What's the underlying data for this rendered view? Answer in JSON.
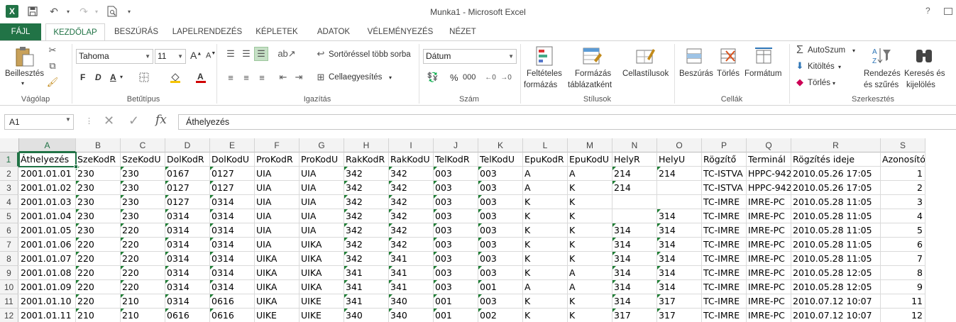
{
  "window": {
    "title": "Munka1 - Microsoft Excel",
    "help": "?"
  },
  "tabs": {
    "file": "FÁJL",
    "home": "KEZDŐLAP",
    "insert": "BESZÚRÁS",
    "layout": "LAPELRENDEZÉS",
    "formulas": "KÉPLETEK",
    "data": "ADATOK",
    "review": "VÉLEMÉNYEZÉS",
    "view": "NÉZET"
  },
  "ribbon": {
    "paste": "Beillesztés",
    "clipboard": "Vágólap",
    "font_name": "Tahoma",
    "font_size": "11",
    "bold": "F",
    "italic": "D",
    "underline": "A",
    "font_group": "Betűtípus",
    "wrap": "Sortöréssel több sorba",
    "merge": "Cellaegyesítés",
    "alignment": "Igazítás",
    "number_format": "Dátum",
    "percent": "%",
    "thousands": "000",
    "number": "Szám",
    "cond_fmt_1": "Feltételes",
    "cond_fmt_2": "formázás",
    "table_fmt_1": "Formázás",
    "table_fmt_2": "táblázatként",
    "cell_styles": "Cellastílusok",
    "styles": "Stílusok",
    "insert": "Beszúrás",
    "delete": "Törlés",
    "format": "Formátum",
    "cells": "Cellák",
    "autosum": "AutoSzum",
    "fill": "Kitöltés",
    "clear": "Törlés",
    "sort_1": "Rendezés",
    "sort_2": "és szűrés",
    "find_1": "Keresés és",
    "find_2": "kijelölés",
    "editing": "Szerkesztés"
  },
  "formula_bar": {
    "name_box": "A1",
    "fx": "fx",
    "value": "Áthelyezés"
  },
  "columns": [
    "A",
    "B",
    "C",
    "D",
    "E",
    "F",
    "G",
    "H",
    "I",
    "J",
    "K",
    "L",
    "M",
    "N",
    "O",
    "P",
    "Q",
    "R",
    "S"
  ],
  "rows": [
    "1",
    "2",
    "3",
    "4",
    "5",
    "6",
    "7",
    "8",
    "9",
    "10",
    "11",
    "12"
  ],
  "headers": [
    "Áthelyezés",
    "SzeKodR",
    "SzeKodU",
    "DolKodR",
    "DolKodU",
    "ProKodR",
    "ProKodU",
    "RakKodR",
    "RakKodU",
    "TelKodR",
    "TelKodU",
    "EpuKodR",
    "EpuKodU",
    "HelyR",
    "HelyU",
    "Rögzítő",
    "Terminál",
    "Rögzítés ideje",
    "Azonosító"
  ],
  "data": [
    [
      "2001.01.01",
      "230",
      "230",
      "0167",
      "0127",
      "UIA",
      "UIA",
      "342",
      "342",
      "003",
      "003",
      "A",
      "A",
      "214",
      "214",
      "TC-ISTVA",
      "HPPC-942",
      "2010.05.26 17:05",
      "1"
    ],
    [
      "2001.01.02",
      "230",
      "230",
      "0127",
      "0127",
      "UIA",
      "UIA",
      "342",
      "342",
      "003",
      "003",
      "A",
      "K",
      "214",
      "",
      "TC-ISTVA",
      "HPPC-942",
      "2010.05.26 17:05",
      "2"
    ],
    [
      "2001.01.03",
      "230",
      "230",
      "0127",
      "0314",
      "UIA",
      "UIA",
      "342",
      "342",
      "003",
      "003",
      "K",
      "K",
      "",
      "",
      "TC-IMRE",
      "IMRE-PC",
      "2010.05.28 11:05",
      "3"
    ],
    [
      "2001.01.04",
      "230",
      "230",
      "0314",
      "0314",
      "UIA",
      "UIA",
      "342",
      "342",
      "003",
      "003",
      "K",
      "K",
      "",
      "314",
      "TC-IMRE",
      "IMRE-PC",
      "2010.05.28 11:05",
      "4"
    ],
    [
      "2001.01.05",
      "230",
      "220",
      "0314",
      "0314",
      "UIA",
      "UIA",
      "342",
      "342",
      "003",
      "003",
      "K",
      "K",
      "314",
      "314",
      "TC-IMRE",
      "IMRE-PC",
      "2010.05.28 11:05",
      "5"
    ],
    [
      "2001.01.06",
      "220",
      "220",
      "0314",
      "0314",
      "UIA",
      "UIKA",
      "342",
      "342",
      "003",
      "003",
      "K",
      "K",
      "314",
      "314",
      "TC-IMRE",
      "IMRE-PC",
      "2010.05.28 11:05",
      "6"
    ],
    [
      "2001.01.07",
      "220",
      "220",
      "0314",
      "0314",
      "UIKA",
      "UIKA",
      "342",
      "341",
      "003",
      "003",
      "K",
      "K",
      "314",
      "314",
      "TC-IMRE",
      "IMRE-PC",
      "2010.05.28 11:05",
      "7"
    ],
    [
      "2001.01.08",
      "220",
      "220",
      "0314",
      "0314",
      "UIKA",
      "UIKA",
      "341",
      "341",
      "003",
      "003",
      "K",
      "A",
      "314",
      "314",
      "TC-IMRE",
      "IMRE-PC",
      "2010.05.28 12:05",
      "8"
    ],
    [
      "2001.01.09",
      "220",
      "220",
      "0314",
      "0314",
      "UIKA",
      "UIKA",
      "341",
      "341",
      "003",
      "001",
      "A",
      "A",
      "314",
      "314",
      "TC-IMRE",
      "IMRE-PC",
      "2010.05.28 12:05",
      "9"
    ],
    [
      "2001.01.10",
      "220",
      "210",
      "0314",
      "0616",
      "UIKA",
      "UIKE",
      "341",
      "340",
      "001",
      "003",
      "K",
      "K",
      "314",
      "317",
      "TC-IMRE",
      "IMRE-PC",
      "2010.07.12 10:07",
      "11"
    ],
    [
      "2001.01.11",
      "210",
      "210",
      "0616",
      "0616",
      "UIKE",
      "UIKE",
      "340",
      "340",
      "001",
      "002",
      "K",
      "K",
      "317",
      "317",
      "TC-IMRE",
      "IMRE-PC",
      "2010.07.12 10:07",
      "12"
    ]
  ]
}
